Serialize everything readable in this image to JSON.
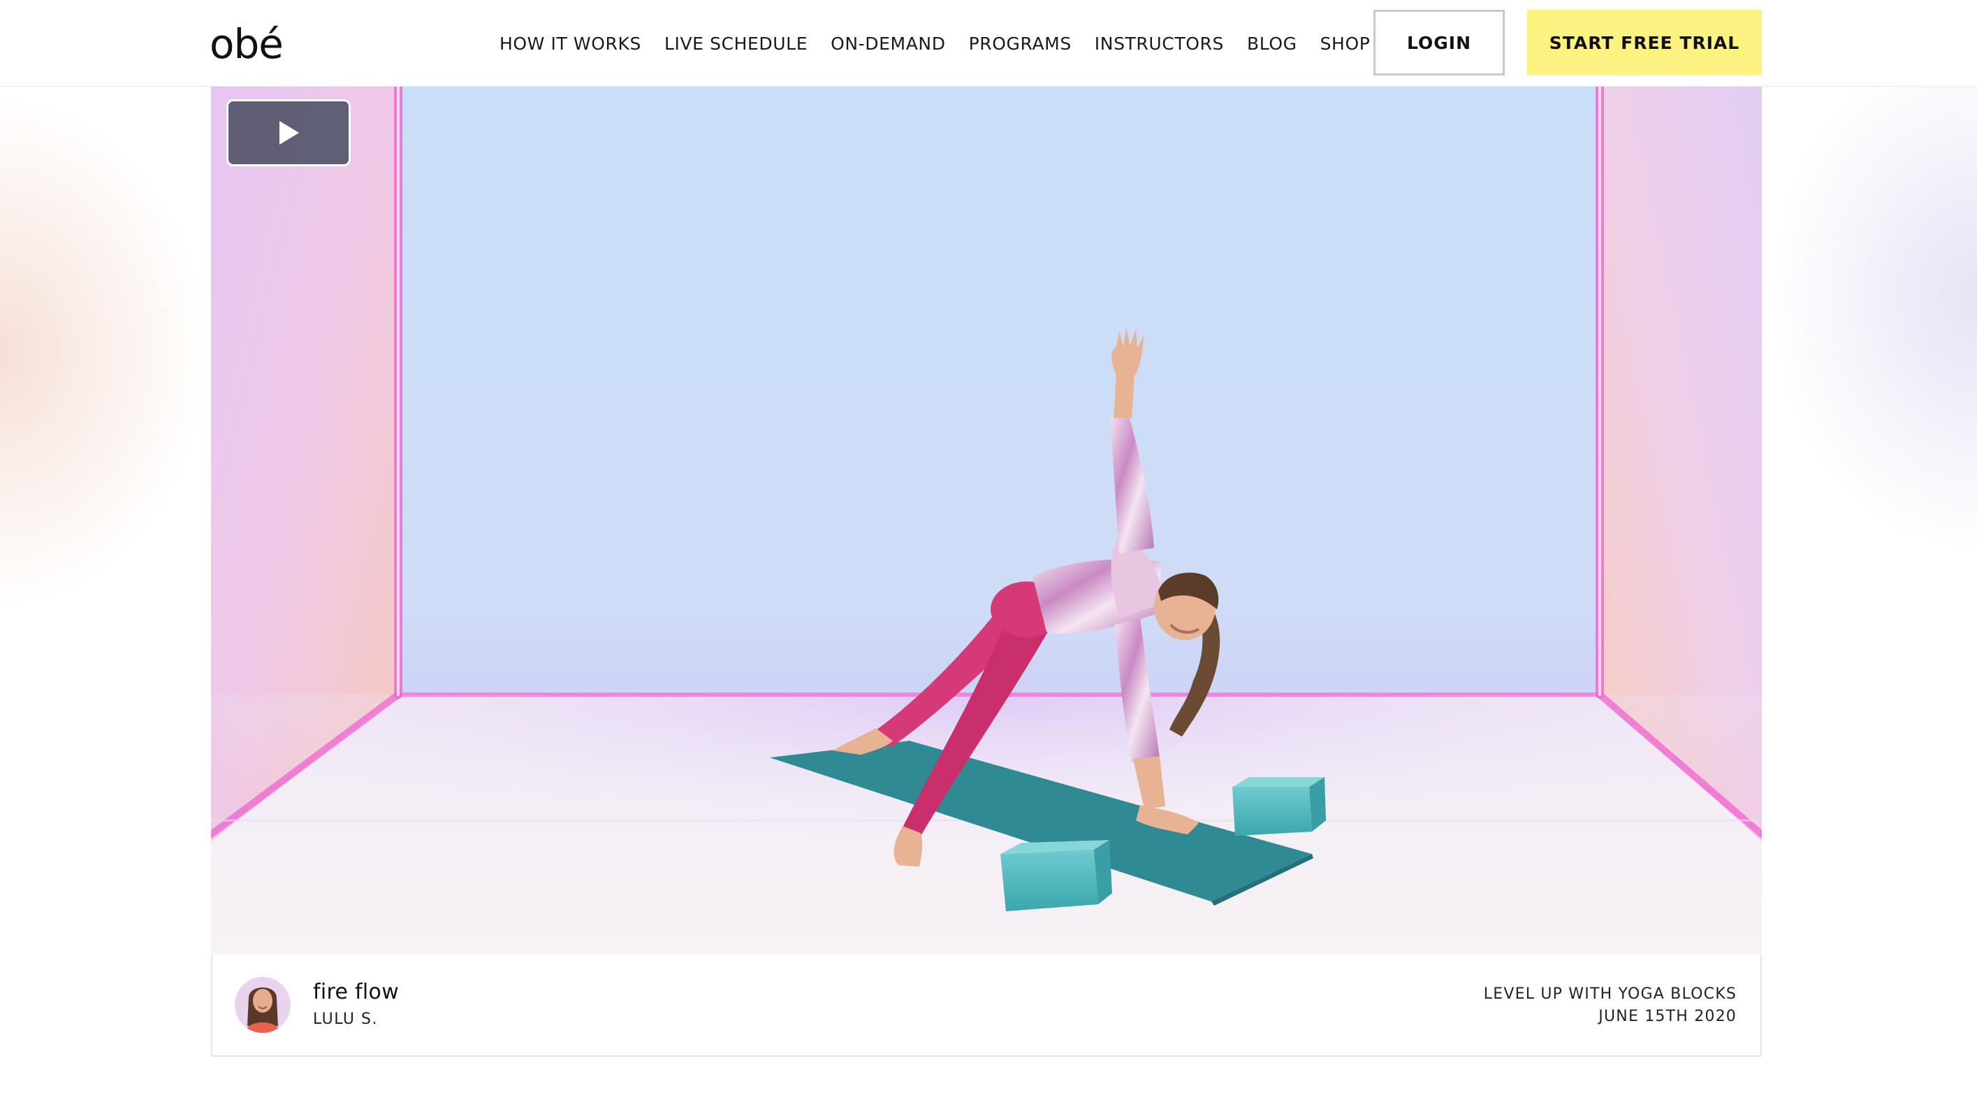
{
  "brand": {
    "logo_text": "obé"
  },
  "nav": {
    "items": [
      {
        "label": "HOW IT WORKS"
      },
      {
        "label": "LIVE SCHEDULE"
      },
      {
        "label": "ON-DEMAND"
      },
      {
        "label": "PROGRAMS"
      },
      {
        "label": "INSTRUCTORS"
      },
      {
        "label": "BLOG"
      },
      {
        "label": "SHOP"
      }
    ],
    "login_label": "LOGIN",
    "trial_label": "START FREE TRIAL"
  },
  "video": {
    "play_icon": "play-icon",
    "state": "paused"
  },
  "caption": {
    "class_title": "fire flow",
    "instructor": "LULU S.",
    "program": "LEVEL UP WITH YOGA BLOCKS",
    "date": "JUNE 15TH 2020"
  },
  "colors": {
    "trial_button": "#fbf37f",
    "login_border": "#c9c9c9",
    "neon_pink": "#f06bd2",
    "mat": "#2f8a94",
    "blocks": "#4cb7be",
    "shirt": "#d9a6d4",
    "leggings": "#d63a76"
  }
}
